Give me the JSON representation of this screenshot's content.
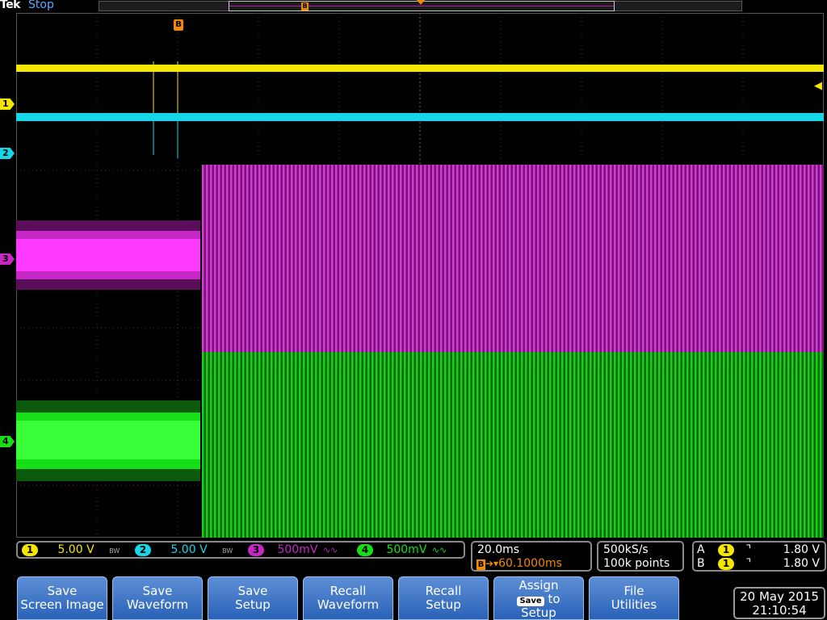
{
  "header": {
    "brand": "Tek",
    "run_state": "Stop",
    "record_b_label": "B"
  },
  "markers": {
    "b_trigger": "B",
    "ch1": "1",
    "ch2": "2",
    "ch3": "3",
    "ch4": "4"
  },
  "channels": [
    {
      "num": "1",
      "scale": "5.00 V",
      "bw": "BW",
      "color": "#f5e600"
    },
    {
      "num": "2",
      "scale": "5.00 V",
      "bw": "BW",
      "color": "#16d7e7"
    },
    {
      "num": "3",
      "scale": "500mV",
      "bw": "∿∿",
      "color": "#c528c5"
    },
    {
      "num": "4",
      "scale": "500mV",
      "bw": "∿∿",
      "color": "#15e015"
    }
  ],
  "timebase": {
    "time_per_div": "20.0ms",
    "b_label": "B",
    "delay": "60.1000ms"
  },
  "acquisition": {
    "sample_rate": "500kS/s",
    "record_length": "100k points"
  },
  "triggers": [
    {
      "label": "A",
      "source": "1",
      "slope": "⌝",
      "level": "1.80 V"
    },
    {
      "label": "B",
      "source": "1",
      "slope": "⌝",
      "level": "1.80 V"
    }
  ],
  "menu": [
    {
      "line1": "Save",
      "line2": "Screen Image"
    },
    {
      "line1": "Save",
      "line2": "Waveform"
    },
    {
      "line1": "Save",
      "line2": "Setup"
    },
    {
      "line1": "Recall",
      "line2": "Waveform"
    },
    {
      "line1": "Recall",
      "line2": "Setup"
    },
    {
      "line1": "Assign",
      "badge": "Save",
      "line2": "to",
      "line3": "Setup"
    },
    {
      "line1": "File",
      "line2": "Utilities"
    }
  ],
  "datetime": {
    "date": "20 May 2015",
    "time": "21:10:54"
  },
  "waveforms": {
    "ch3_burst_onset_fraction": 0.23,
    "ch4_burst_onset_fraction": 0.23
  }
}
